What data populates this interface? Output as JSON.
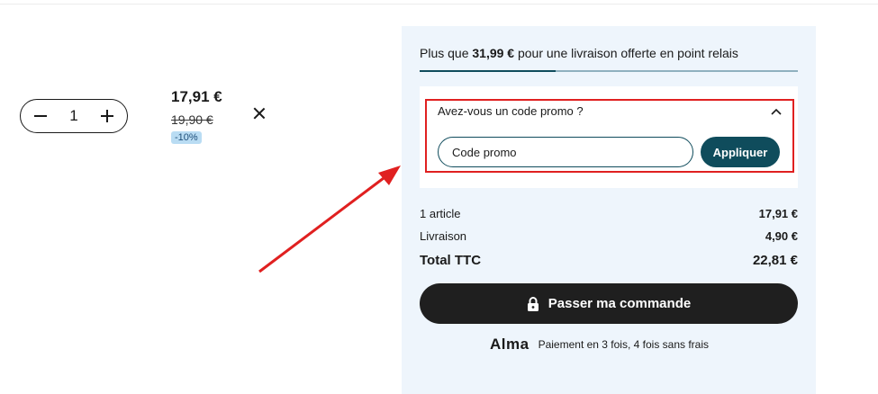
{
  "cart_item": {
    "quantity": "1",
    "price": "17,91 €",
    "old_price": "19,90 €",
    "discount": "-10%"
  },
  "summary": {
    "shipping_prefix": "Plus que ",
    "shipping_amount": "31,99 €",
    "shipping_suffix": " pour une livraison offerte en point relais",
    "shipping_progress": 0.36,
    "promo_question": "Avez-vous un code promo ?",
    "promo_placeholder": "Code promo",
    "apply_label": "Appliquer",
    "rows": [
      {
        "label": "1 article",
        "value": "17,91 €"
      },
      {
        "label": "Livraison",
        "value": "4,90 €"
      }
    ],
    "total_label": "Total TTC",
    "total_value": "22,81 €",
    "order_button": "Passer ma commande",
    "alma_logo": "Alma",
    "alma_text": "Paiement en 3 fois, 4 fois sans frais"
  },
  "icons": [
    "minus-icon",
    "plus-icon",
    "close-icon",
    "chevron-up-icon",
    "lock-icon"
  ],
  "colors": {
    "accent": "#0f4c5c",
    "panel_bg": "#eef5fc",
    "highlight": "#e02020",
    "dark_button": "#1f1f1f",
    "discount_bg": "#b9dcf3"
  }
}
